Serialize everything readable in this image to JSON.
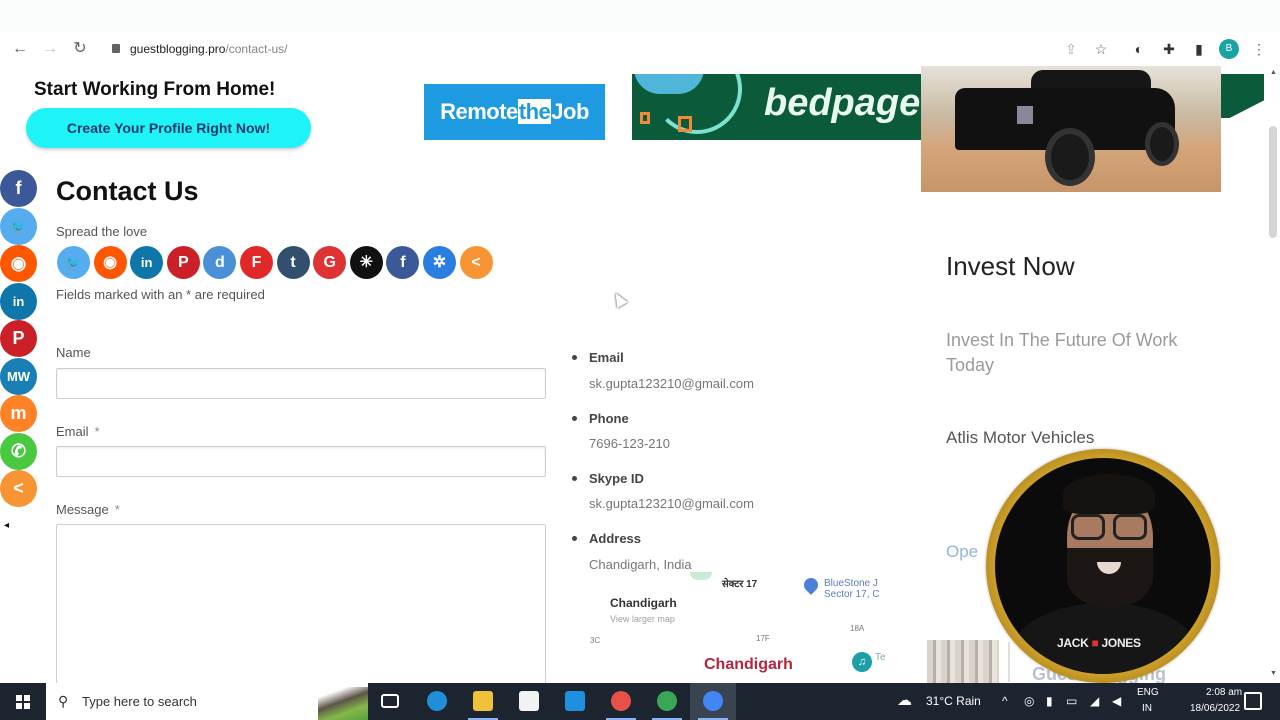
{
  "browser": {
    "url_domain": "guestblogging.pro",
    "url_path": "/contact-us/",
    "profile_initial": "B",
    "icons": [
      "back-icon",
      "forward-icon",
      "reload-icon",
      "lock-icon",
      "share-icon",
      "star-icon",
      "extension-sync-icon",
      "puzzle-icon",
      "sidepanel-icon",
      "profile-avatar",
      "menu-icon"
    ],
    "glyphs": {
      "back": "←",
      "forward": "→",
      "reload": "↻",
      "share": "⇪",
      "star": "☆",
      "sync": "◐",
      "puzzle": "✚",
      "sidepanel": "▮",
      "menu": "⋮"
    }
  },
  "ads": {
    "start_title": "Start Working From Home!",
    "start_button": "Create Your Profile Right Now!",
    "remote_prefix": "Remote",
    "remote_the": "the",
    "remote_suffix": "Job",
    "bedpage": "bedpage"
  },
  "floating_share": {
    "items": [
      {
        "name": "facebook",
        "glyph": "f",
        "color": "#3b5998"
      },
      {
        "name": "twitter",
        "glyph": "🐦",
        "color": "#55acee"
      },
      {
        "name": "reddit",
        "glyph": "◉",
        "color": "#ff5700"
      },
      {
        "name": "linkedin",
        "glyph": "in",
        "color": "#0e76a8"
      },
      {
        "name": "pinterest",
        "glyph": "P",
        "color": "#cb2027"
      },
      {
        "name": "mewe",
        "glyph": "MW",
        "color": "#1a7fb5"
      },
      {
        "name": "mix",
        "glyph": "m",
        "color": "#ff8226"
      },
      {
        "name": "whatsapp",
        "glyph": "✆",
        "color": "#48c93f"
      },
      {
        "name": "share",
        "glyph": "<",
        "color": "#f79433"
      }
    ],
    "collapse_glyph": "◂"
  },
  "main": {
    "title": "Contact Us",
    "spread_label": "Spread the love",
    "share_icons": [
      {
        "name": "twitter",
        "glyph": "🐦",
        "color": "#55acee"
      },
      {
        "name": "reddit",
        "glyph": "◉",
        "color": "#ff5700"
      },
      {
        "name": "linkedin",
        "glyph": "in",
        "color": "#0e76a8"
      },
      {
        "name": "pinterest",
        "glyph": "P",
        "color": "#cb2027"
      },
      {
        "name": "digg",
        "glyph": "d",
        "color": "#4a90d9"
      },
      {
        "name": "flipboard",
        "glyph": "F",
        "color": "#e12828"
      },
      {
        "name": "tumblr",
        "glyph": "t",
        "color": "#32506d"
      },
      {
        "name": "google",
        "glyph": "G",
        "color": "#dd3333"
      },
      {
        "name": "stumble",
        "glyph": "✳",
        "color": "#111111"
      },
      {
        "name": "facebook",
        "glyph": "f",
        "color": "#3b5998"
      },
      {
        "name": "vk",
        "glyph": "✲",
        "color": "#2a7de1"
      },
      {
        "name": "share",
        "glyph": "<",
        "color": "#f79433"
      }
    ],
    "required_note": "Fields marked with an * are required",
    "form": {
      "name_label": "Name",
      "name_value": "",
      "email_label": "Email",
      "email_value": "",
      "message_label": "Message",
      "message_value": "",
      "required_marker": "*"
    }
  },
  "contact_info": {
    "items": [
      {
        "title": "Email",
        "value": "sk.gupta123210@gmail.com"
      },
      {
        "title": "Phone",
        "value": "7696-123-210"
      },
      {
        "title": "Skype ID",
        "value": "sk.gupta123210@gmail.com"
      },
      {
        "title": "Address",
        "value": "Chandigarh, India"
      }
    ],
    "map": {
      "place_label": "Chandigarh",
      "view_larger": "View larger map",
      "sector_label": "सेक्टर 17",
      "poi": "BlueStone J\nSector 17, C",
      "city_big": "Chandigarh",
      "small_1": "3C",
      "small_2": "17F",
      "small_3": "18A",
      "teal_text": "Te"
    }
  },
  "sidebar": {
    "invest_title": "Invest Now",
    "invest_sub": "Invest In The Future Of Work Today",
    "atlis": "Atlis Motor Vehicles",
    "open_link": "Ope",
    "guest_blog": "Guest Blogging"
  },
  "webcam": {
    "shirt_brand_1": "JACK",
    "shirt_brand_sep": "■",
    "shirt_brand_2": "JONES"
  },
  "taskbar": {
    "search_placeholder": "Type here to search",
    "apps": [
      {
        "name": "task-view",
        "color": "#ffffff",
        "active": false,
        "open": false
      },
      {
        "name": "edge",
        "color": "#1e8fd8",
        "active": false,
        "open": false
      },
      {
        "name": "file-explorer",
        "color": "#f0c23a",
        "active": false,
        "open": true
      },
      {
        "name": "microsoft-store",
        "color": "#f2f2f2",
        "active": false,
        "open": false
      },
      {
        "name": "mail",
        "color": "#1e90e0",
        "active": false,
        "open": false
      },
      {
        "name": "chrome-1",
        "color": "#e8504a",
        "active": false,
        "open": true
      },
      {
        "name": "chrome-2",
        "color": "#3aa757",
        "active": false,
        "open": true
      },
      {
        "name": "chrome-3",
        "color": "#4285f4",
        "active": true,
        "open": true
      }
    ],
    "weather": "31°C  Rain",
    "tray_up": "^",
    "lang_1": "ENG",
    "lang_2": "IN",
    "time": "2:08 am",
    "date": "18/06/2022"
  }
}
